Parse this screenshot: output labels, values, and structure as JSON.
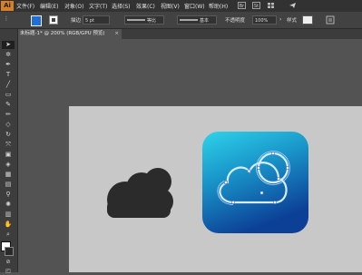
{
  "app": {
    "logo": "Ai"
  },
  "menu": {
    "items": [
      "文件(F)",
      "编辑(E)",
      "对象(O)",
      "文字(T)",
      "选择(S)",
      "效果(C)",
      "视图(V)",
      "窗口(W)",
      "帮助(H)"
    ]
  },
  "control_bar": {
    "fill_color": "#1f6fd6",
    "stroke_label": "描边",
    "stroke_value": "5 pt",
    "profile_label": "等比",
    "brush_label": "基本",
    "opacity_label": "不透明度",
    "opacity_value": "100%",
    "style_label": "样式"
  },
  "document": {
    "tab_title": "未标题-1* @ 200% (RGB/GPU 预览)",
    "close": "×"
  },
  "colors": {
    "workspace": "#535353",
    "artboard": "#c8c8c8",
    "cloud": "#2b2b2b",
    "icon_gradient_top": "#29c9e6",
    "icon_gradient_bottom": "#0d4fa3",
    "selection": "#b9d4ff"
  },
  "icons": [
    "selection-tool",
    "direct-selection-tool",
    "pen-tool",
    "type-tool",
    "line-tool",
    "rectangle-tool",
    "paintbrush-tool",
    "pencil-tool",
    "eraser-tool",
    "rotate-tool",
    "scale-tool",
    "width-tool",
    "shape-builder-tool",
    "perspective-tool",
    "mesh-tool",
    "gradient-tool",
    "eyedropper-tool",
    "blend-tool",
    "symbol-sprayer-tool",
    "column-graph-tool",
    "artboard-tool",
    "slice-tool",
    "hand-tool",
    "zoom-tool"
  ]
}
